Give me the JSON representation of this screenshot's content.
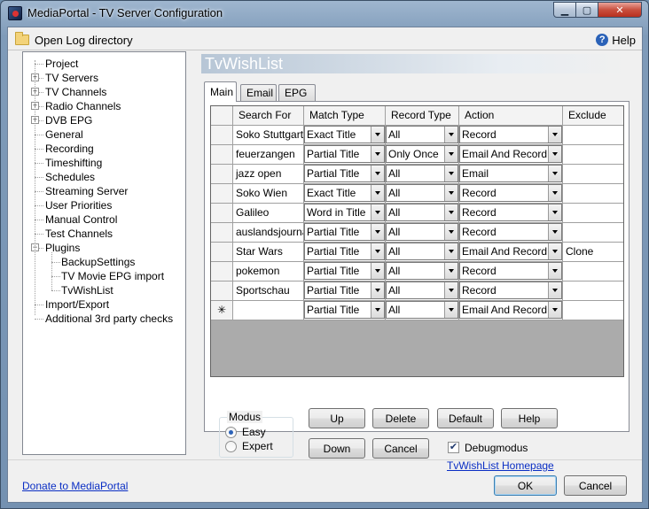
{
  "window": {
    "title": "MediaPortal - TV Server Configuration",
    "min": "▁",
    "max": "▢",
    "close": "✕"
  },
  "topbar": {
    "open_log": "Open Log directory",
    "help": "Help"
  },
  "tree": [
    {
      "label": "Project",
      "depth": 0,
      "expander": ""
    },
    {
      "label": "TV Servers",
      "depth": 0,
      "expander": "+"
    },
    {
      "label": "TV Channels",
      "depth": 0,
      "expander": "+"
    },
    {
      "label": "Radio Channels",
      "depth": 0,
      "expander": "+"
    },
    {
      "label": "DVB EPG",
      "depth": 0,
      "expander": "+"
    },
    {
      "label": "General",
      "depth": 0,
      "expander": ""
    },
    {
      "label": "Recording",
      "depth": 0,
      "expander": ""
    },
    {
      "label": "Timeshifting",
      "depth": 0,
      "expander": ""
    },
    {
      "label": "Schedules",
      "depth": 0,
      "expander": ""
    },
    {
      "label": "Streaming Server",
      "depth": 0,
      "expander": ""
    },
    {
      "label": "User Priorities",
      "depth": 0,
      "expander": ""
    },
    {
      "label": "Manual Control",
      "depth": 0,
      "expander": ""
    },
    {
      "label": "Test Channels",
      "depth": 0,
      "expander": ""
    },
    {
      "label": "Plugins",
      "depth": 0,
      "expander": "−"
    },
    {
      "label": "BackupSettings",
      "depth": 1,
      "expander": ""
    },
    {
      "label": "TV Movie EPG import",
      "depth": 1,
      "expander": ""
    },
    {
      "label": "TvWishList",
      "depth": 1,
      "expander": ""
    },
    {
      "label": "Import/Export",
      "depth": 0,
      "expander": ""
    },
    {
      "label": "Additional 3rd party checks",
      "depth": 0,
      "expander": ""
    }
  ],
  "pane": {
    "title": "TvWishList"
  },
  "tabs": [
    "Main",
    "Email",
    "EPG"
  ],
  "grid": {
    "columns": [
      "Search For",
      "Match Type",
      "Record Type",
      "Action",
      "Exclude"
    ],
    "rows": [
      [
        "Soko Stuttgart",
        "Exact Title",
        "All",
        "Record",
        ""
      ],
      [
        "feuerzangen",
        "Partial Title",
        "Only Once",
        "Email And Record",
        ""
      ],
      [
        "jazz open",
        "Partial Title",
        "All",
        "Email",
        ""
      ],
      [
        "Soko Wien",
        "Exact Title",
        "All",
        "Record",
        ""
      ],
      [
        "Galileo",
        "Word in Title",
        "All",
        "Record",
        ""
      ],
      [
        "auslandsjournal",
        "Partial Title",
        "All",
        "Record",
        ""
      ],
      [
        "Star Wars",
        "Partial Title",
        "All",
        "Email And Record",
        "Clone"
      ],
      [
        "pokemon",
        "Partial Title",
        "All",
        "Record",
        ""
      ],
      [
        "Sportschau",
        "Partial Title",
        "All",
        "Record",
        ""
      ]
    ],
    "new_row": [
      "",
      "Partial Title",
      "All",
      "Email And Record",
      ""
    ],
    "new_row_marker": "✳"
  },
  "modus": {
    "legend": "Modus",
    "options": [
      "Easy",
      "Expert"
    ],
    "selected": "Easy"
  },
  "buttons": {
    "up": "Up",
    "delete": "Delete",
    "default": "Default",
    "help": "Help",
    "down": "Down",
    "cancel_small": "Cancel"
  },
  "debug": {
    "label": "Debugmodus",
    "checked": true,
    "mark": "✔"
  },
  "homepage_link": "TvWishList Homepage",
  "donate_link": "Donate to MediaPortal",
  "footer": {
    "ok": "OK",
    "cancel": "Cancel"
  }
}
